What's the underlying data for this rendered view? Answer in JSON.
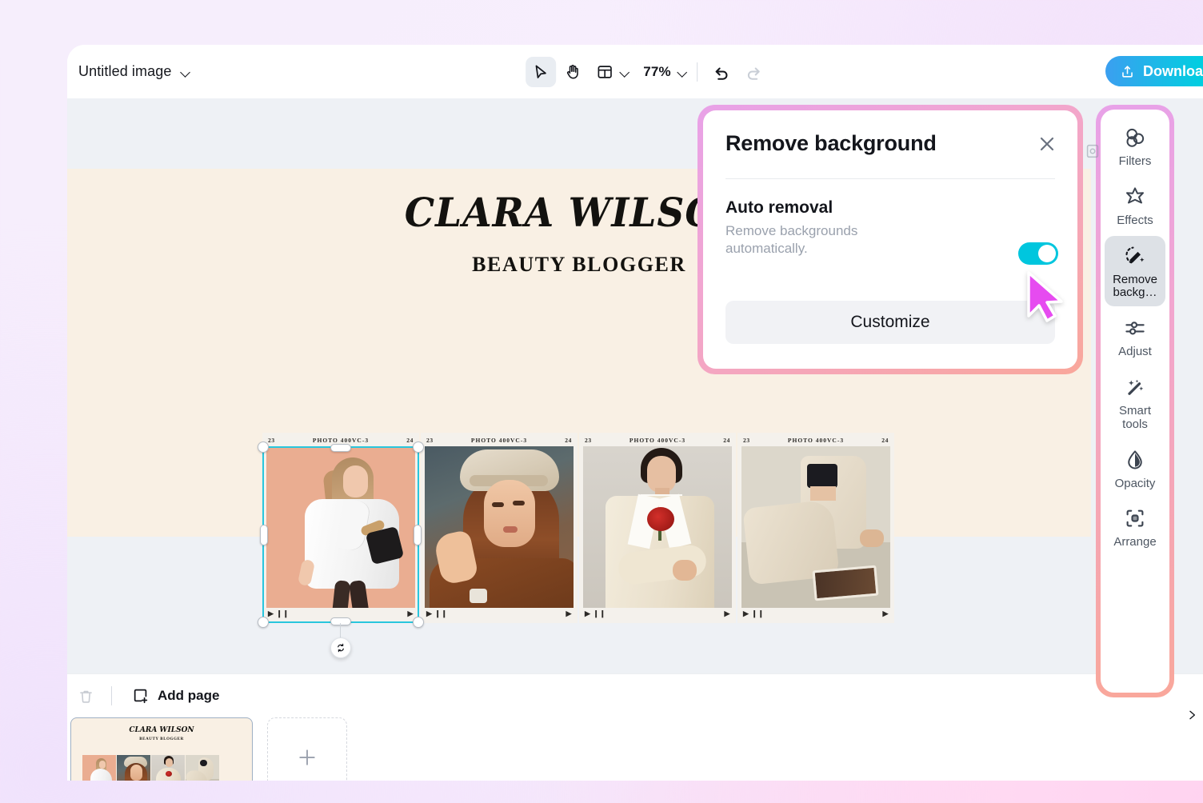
{
  "topbar": {
    "doc_title": "Untitled image",
    "doc_title_chevron": "chevron-down-icon",
    "select_tool": "select-tool",
    "hand_tool": "hand-tool",
    "layout_tool": "layout-tool",
    "zoom_value": "77%",
    "undo": "undo-icon",
    "redo": "redo-icon",
    "download_label": "Download a"
  },
  "canvas": {
    "headline": "CLARA WILSON",
    "subhead": "BEAUTY BLOGGER",
    "page_bg": "#f9f0e4",
    "backdrop": "#eef1f5",
    "selection_color": "#29c6dd",
    "film_cells": [
      {
        "left": "23",
        "center": "PHOTO  400VC-3",
        "right": "24",
        "bottom_left": "▶ ❙❙",
        "bottom_right": "▶",
        "alt": "woman-white-coat-peach"
      },
      {
        "left": "23",
        "center": "PHOTO  400VC-3",
        "right": "24",
        "bottom_left": "▶ ❙❙",
        "bottom_right": "▶",
        "alt": "woman-hat-brown-fur-coat"
      },
      {
        "left": "23",
        "center": "PHOTO  400VC-3",
        "right": "24",
        "bottom_left": "▶ ❙❙",
        "bottom_right": "▶",
        "alt": "woman-cream-suit-red-flower"
      },
      {
        "left": "23",
        "center": "PHOTO  400VC-3",
        "right": "24",
        "bottom_left": "▶ ❙❙",
        "bottom_right": "▶",
        "alt": "woman-seated-beige-suit"
      }
    ]
  },
  "modal": {
    "title": "Remove background",
    "close_icon": "close-icon",
    "auto_title": "Auto removal",
    "auto_desc": "Remove backgrounds automatically.",
    "toggle_state": "on",
    "toggle_color": "#00c6de",
    "customize_label": "Customize",
    "highlight_color": "#f0a6d0"
  },
  "sidebar": {
    "items": [
      {
        "label": "Filters",
        "icon": "filters-icon",
        "active": false
      },
      {
        "label": "Effects",
        "icon": "effects-star-icon",
        "active": false
      },
      {
        "label": "Remove backg…",
        "icon": "remove-background-icon",
        "active": true
      },
      {
        "label": "Adjust",
        "icon": "adjust-sliders-icon",
        "active": false
      },
      {
        "label": "Smart tools",
        "icon": "smart-tools-wand-icon",
        "active": false
      },
      {
        "label": "Opacity",
        "icon": "opacity-droplet-icon",
        "active": false
      },
      {
        "label": "Arrange",
        "icon": "arrange-icon",
        "active": false
      }
    ],
    "highlight_color": "#f0a6d0"
  },
  "bottombar": {
    "delete_icon": "trash-icon",
    "add_page_label": "Add page",
    "add_page_icon": "add-page-icon",
    "thumb_headline": "CLARA WILSON",
    "thumb_subhead": "BEAUTY BLOGGER",
    "add_thumb_icon": "plus-icon",
    "next_icon": "chevron-right-icon"
  },
  "cursor": {
    "name": "mouse-pointer",
    "color": "#e64bf0"
  }
}
